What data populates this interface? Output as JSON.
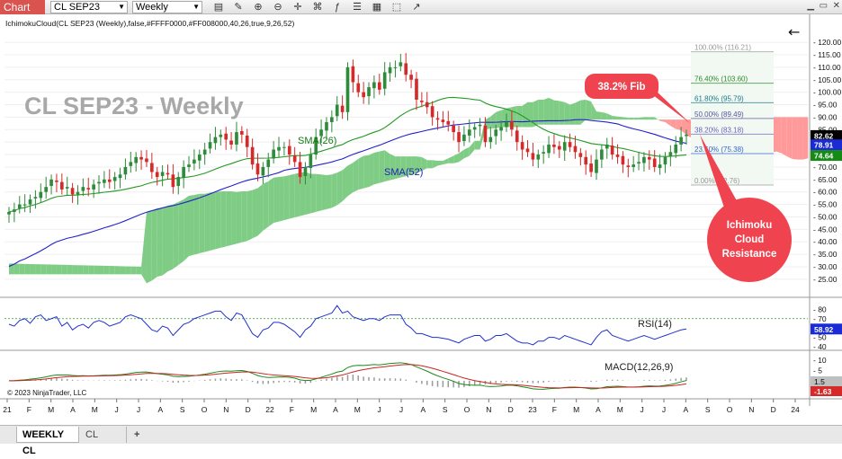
{
  "toolbar": {
    "chart_label": "Chart",
    "instrument": "CL SEP23",
    "period": "Weekly"
  },
  "tabs": [
    "WEEKLY CL",
    "CL"
  ],
  "colors": {
    "up": "#2e8b3a",
    "down": "#d62a2a",
    "sma26": "#229922",
    "sma52": "#2222cc",
    "cloud_green": "#7fcc85",
    "cloud_red": "#ff9a9a",
    "callout": "#ef4450",
    "price_axis_current": "#000000",
    "price_axis_sma52": "#1a2bd6",
    "price_axis_sma26": "#158a15"
  },
  "chart_data": {
    "type": "candlestick",
    "title": "CL SEP23 - Weekly",
    "indicator_title": "IchimokuCloud(CL SEP23 (Weekly),false,#FFFF0000,#FF008000,40,26,true,9,26,52)",
    "copyright": "© 2023 NinjaTrader, LLC",
    "price_axis": {
      "ylim": [
        21,
        124
      ],
      "ticks": [
        120,
        115,
        110,
        105,
        100,
        95,
        90,
        85,
        80,
        75,
        70,
        65,
        60,
        55,
        50,
        45,
        40,
        35,
        30,
        25
      ]
    },
    "price_markers": [
      {
        "label": "82.62",
        "value": 82.62,
        "color": "price_axis_current"
      },
      {
        "label": "78.91",
        "value": 78.91,
        "color": "price_axis_sma52"
      },
      {
        "label": "74.64",
        "value": 74.64,
        "color": "price_axis_sma26"
      }
    ],
    "x_axis": {
      "labels": [
        "21",
        "F",
        "M",
        "A",
        "M",
        "J",
        "J",
        "A",
        "S",
        "O",
        "N",
        "D",
        "22",
        "F",
        "M",
        "A",
        "M",
        "J",
        "J",
        "A",
        "S",
        "O",
        "N",
        "D",
        "23",
        "F",
        "M",
        "A",
        "M",
        "J",
        "J",
        "A",
        "S",
        "O",
        "N",
        "D",
        "24"
      ],
      "start_month": "2021-01",
      "months": 37
    },
    "closes": [
      52,
      53,
      55,
      55,
      57,
      58,
      60,
      62,
      65,
      64,
      61,
      62,
      59,
      60,
      62,
      61,
      63,
      64,
      65,
      64,
      66,
      67,
      70,
      72,
      74,
      73,
      72,
      68,
      66,
      68,
      67,
      62,
      66,
      70,
      71,
      73,
      75,
      77,
      80,
      82,
      83,
      81,
      79,
      84,
      83,
      78,
      71,
      67,
      70,
      73,
      77,
      78,
      78,
      75,
      72,
      66,
      70,
      75,
      82,
      85,
      88,
      90,
      95,
      92,
      110,
      104,
      100,
      98,
      102,
      104,
      101,
      108,
      110,
      110,
      112,
      107,
      105,
      97,
      96,
      94,
      90,
      89,
      88,
      87,
      84,
      80,
      83,
      85,
      86,
      87,
      80,
      82,
      85,
      86,
      88,
      85,
      80,
      77,
      76,
      73,
      75,
      76,
      79,
      78,
      77,
      80,
      78,
      76,
      74,
      71,
      68,
      73,
      77,
      79,
      75,
      74,
      71,
      70,
      71,
      72,
      74,
      73,
      70,
      71,
      74,
      76,
      79,
      82,
      83
    ],
    "series": [
      {
        "name": "SMA(26)",
        "label_value": 74.64
      },
      {
        "name": "SMA(52)",
        "label_value": 78.91
      },
      {
        "name": "Ichimoku Cloud"
      }
    ],
    "fib_levels": [
      {
        "label": "100.00% (116.21)",
        "value": 116.21,
        "color": "#999999"
      },
      {
        "label": "76.40% (103.60)",
        "value": 103.6,
        "color": "#2a8a2a"
      },
      {
        "label": "61.80% (95.79)",
        "value": 95.79,
        "color": "#1a7a8a"
      },
      {
        "label": "50.00% (89.49)",
        "value": 89.49,
        "color": "#555599"
      },
      {
        "label": "38.20% (83.18)",
        "value": 83.18,
        "color": "#6666bb"
      },
      {
        "label": "23.60% (75.38)",
        "value": 75.38,
        "color": "#3366cc"
      },
      {
        "label": "0.00% (62.76)",
        "value": 62.76,
        "color": "#999999"
      }
    ],
    "rsi": {
      "title": "RSI(14)",
      "ylim": [
        40,
        88
      ],
      "ticks": [
        80,
        70,
        60,
        50,
        40
      ],
      "value_label": "58.92",
      "values": [
        64,
        62,
        68,
        70,
        65,
        72,
        74,
        68,
        70,
        72,
        62,
        66,
        58,
        62,
        64,
        60,
        66,
        68,
        66,
        62,
        64,
        66,
        72,
        74,
        72,
        70,
        64,
        58,
        56,
        62,
        60,
        52,
        58,
        64,
        66,
        70,
        72,
        74,
        76,
        78,
        78,
        72,
        68,
        76,
        74,
        64,
        54,
        50,
        58,
        60,
        66,
        66,
        64,
        60,
        56,
        50,
        58,
        62,
        70,
        72,
        74,
        76,
        84,
        76,
        78,
        72,
        70,
        68,
        70,
        70,
        68,
        72,
        74,
        74,
        74,
        64,
        60,
        54,
        54,
        52,
        50,
        50,
        49,
        48,
        46,
        44,
        48,
        50,
        52,
        52,
        46,
        48,
        52,
        52,
        54,
        50,
        46,
        44,
        44,
        42,
        46,
        46,
        50,
        50,
        48,
        52,
        50,
        48,
        46,
        44,
        42,
        50,
        56,
        58,
        52,
        50,
        48,
        46,
        48,
        50,
        52,
        50,
        48,
        50,
        52,
        54,
        56,
        58,
        59
      ]
    },
    "macd": {
      "title": "MACD(12,26,9)",
      "ylim": [
        -7,
        13
      ],
      "ticks": [
        10,
        5,
        0
      ],
      "value_labels": [
        "1.5",
        "-1.63"
      ]
    },
    "annotations": {
      "fib_callout": "38.2% Fib",
      "cloud_callout": [
        "Ichimoku",
        "Cloud",
        "Resistance"
      ]
    }
  }
}
